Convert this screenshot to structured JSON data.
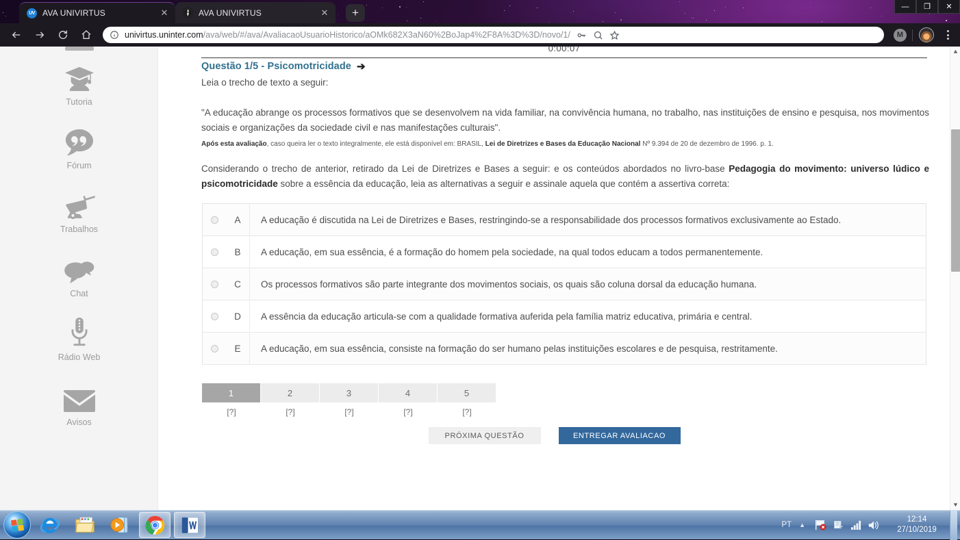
{
  "browser": {
    "tabs": [
      {
        "title": "AVA UNIVIRTUS",
        "favicon": "uv-logo-icon",
        "active": true
      },
      {
        "title": "AVA UNIVIRTUS",
        "favicon": "globe-icon",
        "active": false
      }
    ],
    "newtab_label": "+",
    "window_controls": {
      "minimize": "—",
      "maximize": "❐",
      "close": "✕"
    },
    "toolbar": {
      "back_icon": "back-arrow-icon",
      "forward_icon": "forward-arrow-icon",
      "reload_icon": "reload-icon",
      "home_icon": "home-icon",
      "info_icon": "site-info-icon",
      "url_host": "univirtus.uninter.com",
      "url_path": "/ava/web/#/ava/AvaliacaoUsuarioHistorico/aOMk682X3aN60%2BoJap4%2F8A%3D%3D/novo/1/",
      "key_icon": "password-key-icon",
      "zoom_icon": "zoom-out-icon",
      "bookmark_icon": "star-icon",
      "extension_badge": "M",
      "avatar": "profile-avatar",
      "menu_icon": "kebab-menu-icon"
    }
  },
  "sidebar": {
    "items": [
      {
        "label": "Tutoria",
        "icon": "graduation-cap-icon"
      },
      {
        "label": "Fórum",
        "icon": "quote-bubble-icon"
      },
      {
        "label": "Trabalhos",
        "icon": "wheelbarrow-icon"
      },
      {
        "label": "Chat",
        "icon": "chat-bubbles-icon"
      },
      {
        "label": "Rádio Web",
        "icon": "microphone-icon"
      },
      {
        "label": "Avisos",
        "icon": "envelope-icon"
      }
    ]
  },
  "exam": {
    "timer": "0:00:07",
    "question_title": "Questão 1/5 - Psicomotricidade",
    "title_arrow": "➔",
    "lead": "Leia o trecho de texto a seguir:",
    "quote": "\"A educação abrange os processos formativos que se desenvolvem na vida familiar, na convivência humana, no trabalho, nas instituições de ensino e pesquisa, nos movimentos sociais e organizações da sociedade civil e nas manifestações culturais\".",
    "source_bold_1": "Após esta avaliação",
    "source_mid": ", caso queira ler o texto integralmente, ele está disponível em: BRASIL, ",
    "source_bold_2": "Lei de Diretrizes e Bases da Educação Nacional",
    "source_end": " Nº 9.394 de 20 de dezembro de 1996. p. 1.",
    "ask_part_1": "Considerando o trecho de anterior, retirado da Lei de Diretrizes e Bases a seguir: e os conteúdos abordados no livro-base ",
    "ask_bold": "Pedagogia do movimento: universo lúdico e psicomotricidade",
    "ask_part_2": " sobre a essência da educação, leia as alternativas a seguir e assinale aquela que contém a assertiva correta:",
    "alternatives": [
      {
        "letter": "A",
        "text": "A educação é discutida na Lei de Diretrizes e Bases, restringindo-se a responsabilidade dos processos formativos exclusivamente ao Estado.",
        "selected": false
      },
      {
        "letter": "B",
        "text": "A educação, em sua essência, é a formação do homem pela sociedade, na qual todos educam a todos permanentemente.",
        "selected": false
      },
      {
        "letter": "C",
        "text": "Os processos formativos são parte integrante dos movimentos sociais, os quais são coluna dorsal da educação humana.",
        "selected": false
      },
      {
        "letter": "D",
        "text": "A essência da educação articula-se com a qualidade formativa auferida pela família matriz educativa, primária e central.",
        "selected": false
      },
      {
        "letter": "E",
        "text": "A educação, em sua essência, consiste na formação do ser humano pelas instituições escolares e de pesquisa, restritamente.",
        "selected": false
      }
    ],
    "question_nav": [
      {
        "number": "1",
        "status": "[?]",
        "current": true
      },
      {
        "number": "2",
        "status": "[?]",
        "current": false
      },
      {
        "number": "3",
        "status": "[?]",
        "current": false
      },
      {
        "number": "4",
        "status": "[?]",
        "current": false
      },
      {
        "number": "5",
        "status": "[?]",
        "current": false
      }
    ],
    "next_button": "PRÓXIMA QUESTÃO",
    "submit_button": "ENTREGAR AVALIACAO",
    "submit_color": "#33689d"
  },
  "taskbar": {
    "start_icon": "windows-start-orb-icon",
    "items": [
      {
        "icon": "internet-explorer-icon",
        "open": false
      },
      {
        "icon": "windows-explorer-icon",
        "open": false
      },
      {
        "icon": "media-player-icon",
        "open": false
      },
      {
        "icon": "google-chrome-icon",
        "open": true
      },
      {
        "icon": "microsoft-word-icon",
        "open": true
      }
    ],
    "tray": {
      "language": "PT",
      "overflow_icon": "chevron-up-icon",
      "action_center_icon": "flag-alert-icon",
      "network_icon": "network-icon",
      "signal_icon": "signal-bars-icon",
      "volume_icon": "speaker-icon",
      "time": "12:14",
      "date": "27/10/2019"
    }
  }
}
